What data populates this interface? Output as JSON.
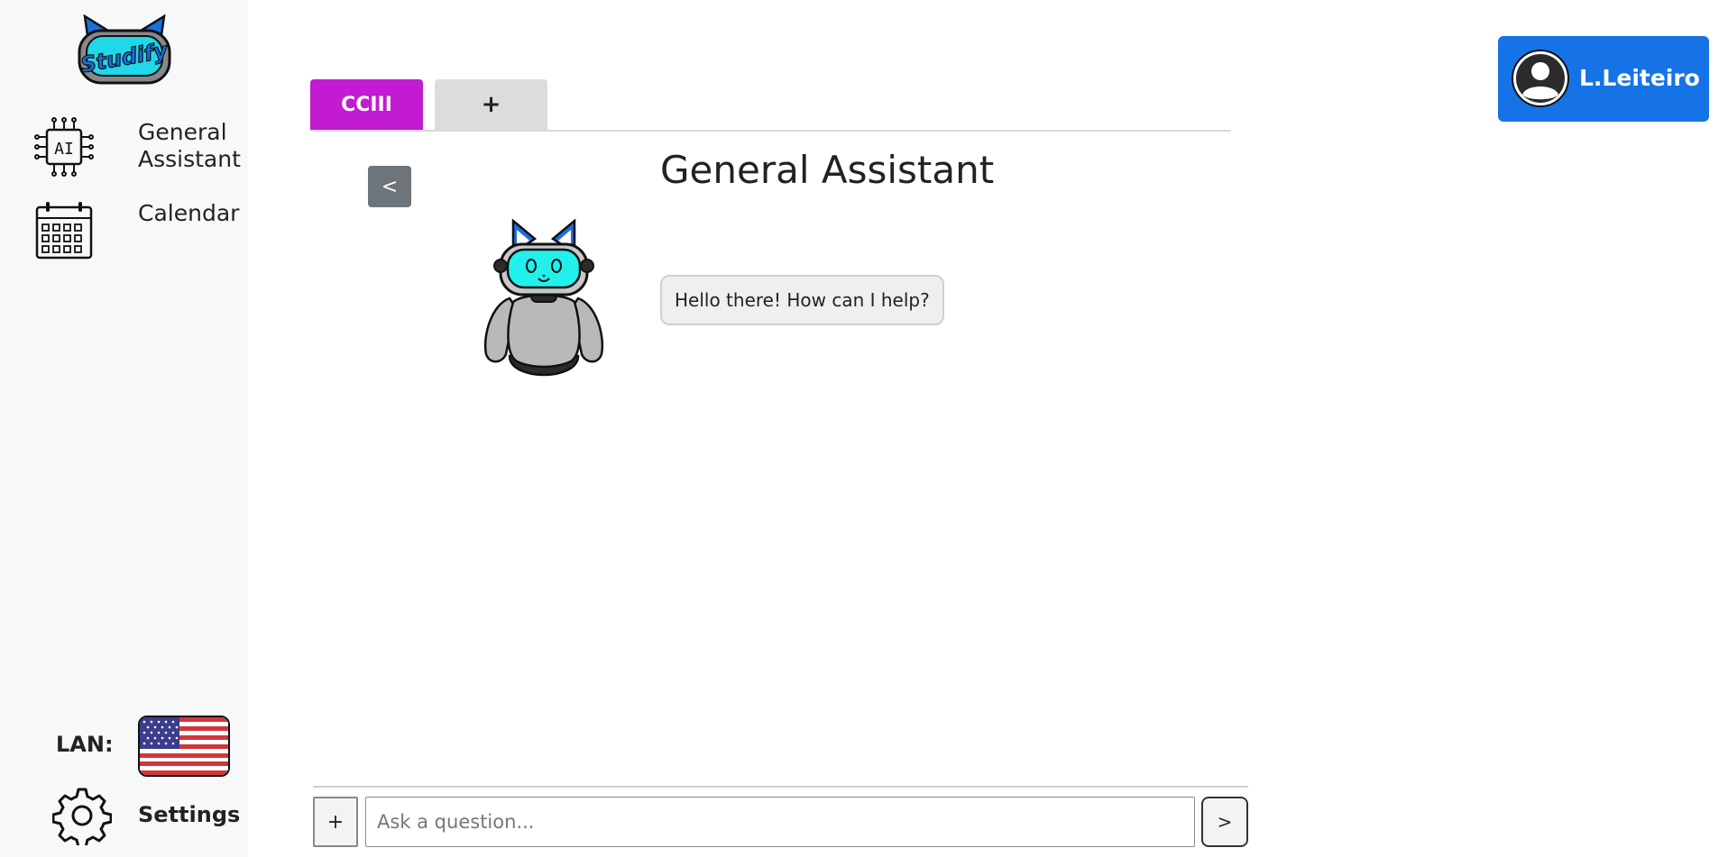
{
  "brand": {
    "logo_icon": "studify-cat-helmet-logo"
  },
  "sidebar": {
    "items": [
      {
        "label": "General Assistant",
        "icon": "ai-chip-icon"
      },
      {
        "label": "Calendar",
        "icon": "calendar-icon"
      }
    ],
    "language_label": "LAN:",
    "language_icon": "us-flag-icon",
    "settings_label": "Settings",
    "settings_icon": "gear-icon"
  },
  "tabs": [
    {
      "label": "CCIII",
      "active": true,
      "color": "#c21bd1"
    },
    {
      "label": "+",
      "active": false
    }
  ],
  "chat": {
    "back_label": "<",
    "title": "General Assistant",
    "mascot_icon": "robot-cat-mascot",
    "messages": [
      {
        "from": "assistant",
        "text": "Hello there! How can I help?"
      }
    ]
  },
  "input": {
    "attach_label": "+",
    "placeholder": "Ask a question...",
    "value": "",
    "send_label": ">"
  },
  "user": {
    "name": "L.Leiteiro",
    "avatar_icon": "user-avatar-icon",
    "color": "#1673e6"
  }
}
